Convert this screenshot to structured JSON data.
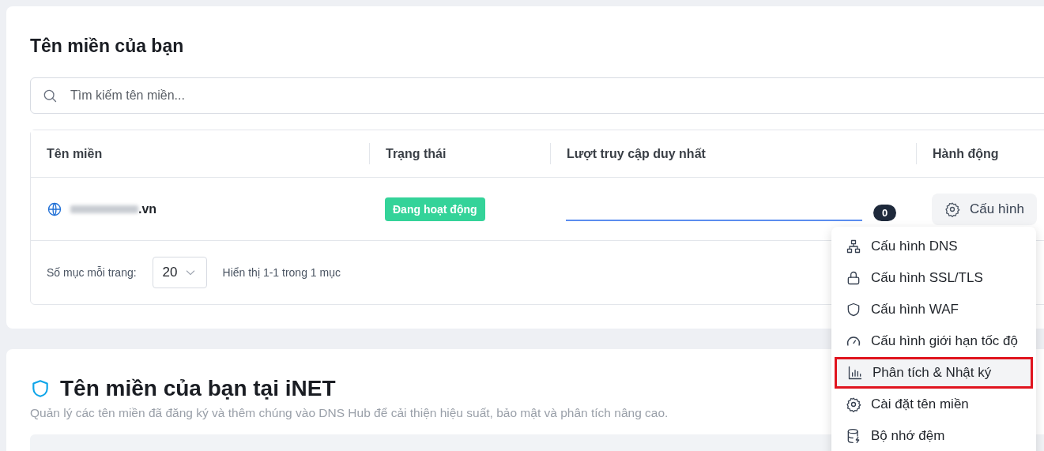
{
  "domains_card": {
    "title": "Tên miền của bạn",
    "search": {
      "placeholder": "Tìm kiếm tên miền..."
    },
    "table": {
      "columns": [
        "Tên miền",
        "Trạng thái",
        "Lượt truy cập duy nhất",
        "Hành động"
      ],
      "rows": [
        {
          "domain": ".vn",
          "domain_redacted": true,
          "status": "Đang hoạt động",
          "visits_badge": "0",
          "action": "Cấu hình"
        }
      ]
    },
    "pagination": {
      "per_page_label": "Số mục mỗi trang:",
      "per_page": "20",
      "summary": "Hiển thị 1-1 trong 1 mục"
    }
  },
  "action_menu": {
    "items": [
      {
        "label": "Cấu hình DNS",
        "selected": false
      },
      {
        "label": "Cấu hình SSL/TLS",
        "selected": false
      },
      {
        "label": "Cấu hình WAF",
        "selected": false
      },
      {
        "label": "Cấu hình giới hạn tốc độ",
        "selected": false
      },
      {
        "label": "Phân tích & Nhật ký",
        "selected": true
      },
      {
        "label": "Cài đặt tên miền",
        "selected": false
      },
      {
        "label": "Bộ nhớ đệm",
        "selected": false
      }
    ]
  },
  "inet_card": {
    "title": "Tên miền của bạn tại iNET",
    "subtitle": "Quản lý các tên miền đã đăng ký và thêm chúng vào DNS Hub để cải thiện hiệu suất, bảo mật và phân tích nâng cao."
  }
}
